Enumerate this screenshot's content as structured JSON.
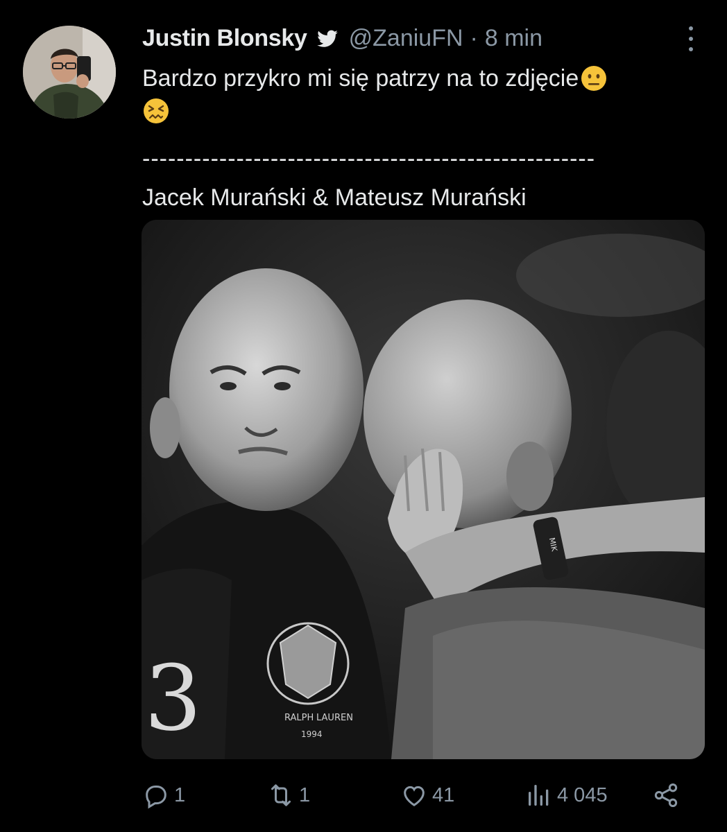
{
  "tweet": {
    "author_name": "Justin Blonsky",
    "handle": "@ZaniuFN",
    "separator": "·",
    "time": "8 min",
    "text_line1": "Bardzo przykro mi się patrzy na to zdjęcie",
    "divider": "-----------------------------------------------------",
    "names_line": "Jacek Murański & Mateusz Murański",
    "emojis": [
      "neutral-face-emoji",
      "confounded-face-emoji"
    ],
    "image_lettering": [
      "3",
      "RALPH",
      "LAUREN",
      "1994",
      "MIK"
    ]
  },
  "actions": {
    "reply_count": "1",
    "retweet_count": "1",
    "like_count": "41",
    "views_count": "4 045"
  },
  "colors": {
    "background": "#000000",
    "text": "#e7e9ea",
    "secondary": "#8b98a5",
    "emoji": "#f6c33a"
  }
}
